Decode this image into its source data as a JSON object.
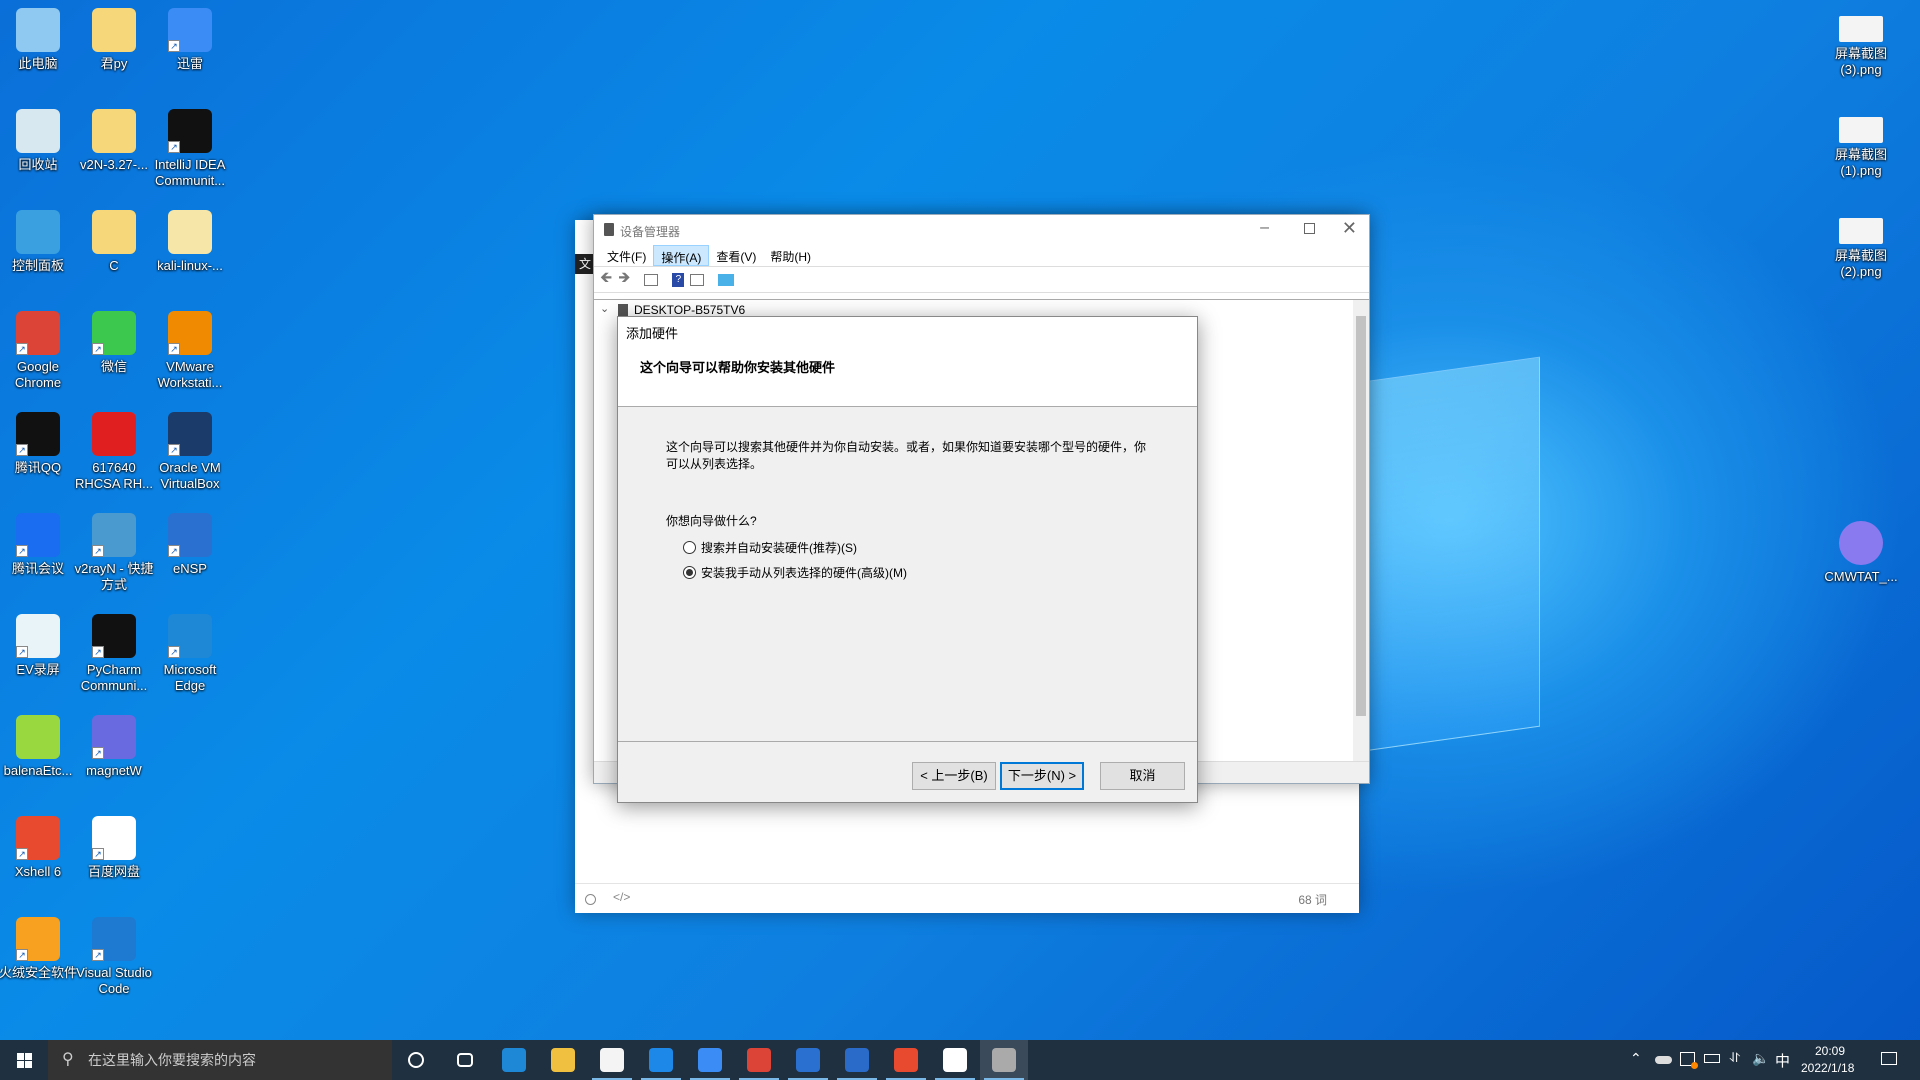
{
  "desktop": {
    "left_icons": [
      {
        "label": "此电脑",
        "col": 0,
        "row": 0,
        "color": "#8fc8f0",
        "shortcut": false
      },
      {
        "label": "君py",
        "col": 1,
        "row": 0,
        "color": "#f6d77a",
        "shortcut": false
      },
      {
        "label": "迅雷",
        "col": 2,
        "row": 0,
        "color": "#3c8cf5",
        "shortcut": true
      },
      {
        "label": "回收站",
        "col": 0,
        "row": 1,
        "color": "#d8e8f0",
        "shortcut": false
      },
      {
        "label": "v2N-3.27-...",
        "col": 1,
        "row": 1,
        "color": "#f6d77a",
        "shortcut": false
      },
      {
        "label": "IntelliJ IDEA Communit...",
        "col": 2,
        "row": 1,
        "color": "#111",
        "shortcut": true
      },
      {
        "label": "控制面板",
        "col": 0,
        "row": 2,
        "color": "#3aa0e0",
        "shortcut": false
      },
      {
        "label": "C",
        "col": 1,
        "row": 2,
        "color": "#f6d77a",
        "shortcut": false
      },
      {
        "label": "kali-linux-...",
        "col": 2,
        "row": 2,
        "color": "#f6e6a8",
        "shortcut": false
      },
      {
        "label": "Google Chrome",
        "col": 0,
        "row": 3,
        "color": "#db4437",
        "shortcut": true
      },
      {
        "label": "微信",
        "col": 1,
        "row": 3,
        "color": "#3cc74f",
        "shortcut": true
      },
      {
        "label": "VMware Workstati...",
        "col": 2,
        "row": 3,
        "color": "#f08a00",
        "shortcut": true
      },
      {
        "label": "腾讯QQ",
        "col": 0,
        "row": 4,
        "color": "#111",
        "shortcut": true
      },
      {
        "label": "617640 RHCSA RH...",
        "col": 1,
        "row": 4,
        "color": "#e02020",
        "shortcut": false
      },
      {
        "label": "Oracle VM VirtualBox",
        "col": 2,
        "row": 4,
        "color": "#1b3b6a",
        "shortcut": true
      },
      {
        "label": "腾讯会议",
        "col": 0,
        "row": 5,
        "color": "#1a6cf0",
        "shortcut": true
      },
      {
        "label": "v2rayN - 快捷方式",
        "col": 1,
        "row": 5,
        "color": "#4a9ad0",
        "shortcut": true
      },
      {
        "label": "eNSP",
        "col": 2,
        "row": 5,
        "color": "#2a70d0",
        "shortcut": true
      },
      {
        "label": "EV录屏",
        "col": 0,
        "row": 6,
        "color": "#e8f4f8",
        "shortcut": true
      },
      {
        "label": "PyCharm Communi...",
        "col": 1,
        "row": 6,
        "color": "#111",
        "shortcut": true
      },
      {
        "label": "Microsoft Edge",
        "col": 2,
        "row": 6,
        "color": "#1e88d6",
        "shortcut": true
      },
      {
        "label": "balenaEtc...",
        "col": 0,
        "row": 7,
        "color": "#9ad840",
        "shortcut": false
      },
      {
        "label": "magnetW",
        "col": 1,
        "row": 7,
        "color": "#6a6ae0",
        "shortcut": true
      },
      {
        "label": "Xshell 6",
        "col": 0,
        "row": 8,
        "color": "#e84a30",
        "shortcut": true
      },
      {
        "label": "百度网盘",
        "col": 1,
        "row": 8,
        "color": "#ffffff",
        "shortcut": true
      },
      {
        "label": "火绒安全软件",
        "col": 0,
        "row": 9,
        "color": "#f8a020",
        "shortcut": true
      },
      {
        "label": "Visual Studio Code",
        "col": 1,
        "row": 9,
        "color": "#1e7ad0",
        "shortcut": true
      }
    ],
    "right_icons": [
      {
        "label": "屏幕截图 (3).png",
        "row": 0,
        "color": "#f4f4f4"
      },
      {
        "label": "屏幕截图 (1).png",
        "row": 1,
        "color": "#f4f4f4"
      },
      {
        "label": "屏幕截图 (2).png",
        "row": 2,
        "color": "#f4f4f4"
      },
      {
        "label": "CMWTAT_...",
        "row": 5,
        "color": "#8a7af0"
      }
    ]
  },
  "editor": {
    "word_count": "68 词",
    "side_text": "文"
  },
  "device_manager": {
    "title": "设备管理器",
    "menu": [
      "文件(F)",
      "操作(A)",
      "查看(V)",
      "帮助(H)"
    ],
    "active_menu": "操作(A)",
    "tree_root": "DESKTOP-B575TV6"
  },
  "wizard": {
    "title": "添加硬件",
    "heading": "这个向导可以帮助你安装其他硬件",
    "description": "这个向导可以搜索其他硬件并为你自动安装。或者，如果你知道要安装哪个型号的硬件，你可以从列表选择。",
    "question": "你想向导做什么?",
    "options": [
      {
        "label": "搜索并自动安装硬件(推荐)(S)",
        "selected": false
      },
      {
        "label": "安装我手动从列表选择的硬件(高级)(M)",
        "selected": true
      }
    ],
    "back": "< 上一步(B)",
    "next": "下一步(N) >",
    "cancel": "取消"
  },
  "taskbar": {
    "search_placeholder": "在这里输入你要搜索的内容",
    "apps": [
      "cortana",
      "task-view",
      "edge",
      "file-explorer",
      "store",
      "mail",
      "xunlei",
      "chrome",
      "ensp",
      "photos",
      "xshell",
      "typora",
      "device-manager"
    ],
    "time": "20:09",
    "date": "2022/1/18",
    "ime": "中"
  }
}
